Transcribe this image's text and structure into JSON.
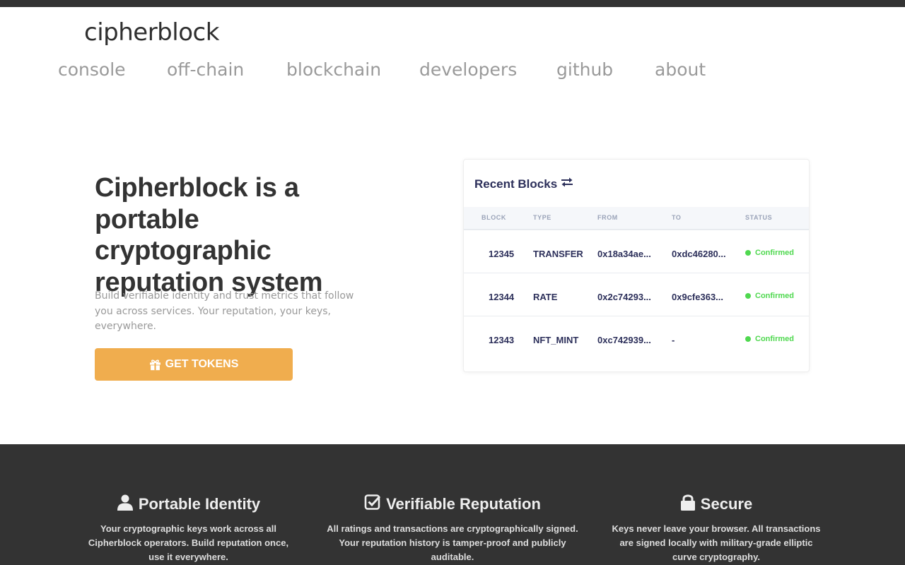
{
  "brand": {
    "name": "cipherblock"
  },
  "nav": {
    "items": [
      {
        "label": "console"
      },
      {
        "label": "off-chain"
      },
      {
        "label": "blockchain"
      },
      {
        "label": "developers"
      },
      {
        "label": "github"
      },
      {
        "label": "about"
      }
    ]
  },
  "hero": {
    "title": "Cipherblock is a portable cryptographic reputation system",
    "subtitle": "Build verifiable identity and trust metrics that follow you across services. Your reputation, your keys, everywhere.",
    "cta_label": "GET TOKENS",
    "cta_icon": "gift-icon",
    "cta_color": "#f0ad4e"
  },
  "recent_blocks": {
    "title": "Recent Blocks",
    "title_icon": "exchange-icon",
    "columns": [
      "BLOCK",
      "TYPE",
      "FROM",
      "TO",
      "STATUS"
    ],
    "rows": [
      {
        "block": "12345",
        "type": "TRANSFER",
        "from": "0x18a34ae...",
        "to": "0xdc46280...",
        "status": "Confirmed"
      },
      {
        "block": "12344",
        "type": "RATE",
        "from": "0x2c74293...",
        "to": "0x9cfe363...",
        "status": "Confirmed"
      },
      {
        "block": "12343",
        "type": "NFT_MINT",
        "from": "0xc742939...",
        "to": "-",
        "status": "Confirmed"
      }
    ],
    "status_color": "#4fd84f"
  },
  "features": [
    {
      "title": "Portable Identity",
      "icon": "user-icon",
      "body": "Your cryptographic keys work across all Cipherblock operators. Build reputation once, use it everywhere."
    },
    {
      "title": "Verifiable Reputation",
      "icon": "check-square-icon",
      "body": "All ratings and transactions are cryptographically signed. Your reputation history is tamper-proof and publicly auditable."
    },
    {
      "title": "Secure",
      "icon": "lock-icon",
      "body": "Keys never leave your browser. All transactions are signed locally with military-grade elliptic curve cryptography."
    }
  ]
}
